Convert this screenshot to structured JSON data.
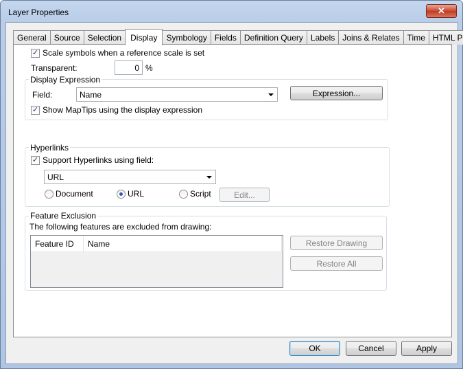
{
  "window": {
    "title": "Layer Properties",
    "close_glyph": "✕"
  },
  "tabs": [
    {
      "label": "General",
      "active": false
    },
    {
      "label": "Source",
      "active": false
    },
    {
      "label": "Selection",
      "active": false
    },
    {
      "label": "Display",
      "active": true
    },
    {
      "label": "Symbology",
      "active": false
    },
    {
      "label": "Fields",
      "active": false
    },
    {
      "label": "Definition Query",
      "active": false
    },
    {
      "label": "Labels",
      "active": false
    },
    {
      "label": "Joins & Relates",
      "active": false
    },
    {
      "label": "Time",
      "active": false
    },
    {
      "label": "HTML Popup",
      "active": false
    }
  ],
  "display": {
    "scale_symbols_label": "Scale symbols when a reference scale is set",
    "scale_symbols_checked": true,
    "transparent_label": "Transparent:",
    "transparent_value": "0",
    "transparent_unit": "%"
  },
  "display_expression": {
    "group_label": "Display Expression",
    "field_label": "Field:",
    "field_value": "Name",
    "expression_button": "Expression...",
    "maptips_label": "Show MapTips using the display expression",
    "maptips_checked": true
  },
  "hyperlinks": {
    "group_label": "Hyperlinks",
    "support_label": "Support Hyperlinks using field:",
    "support_checked": true,
    "field_value": "URL",
    "radio_document": "Document",
    "radio_url": "URL",
    "radio_script": "Script",
    "selected": "URL",
    "edit_button": "Edit..."
  },
  "feature_exclusion": {
    "group_label": "Feature Exclusion",
    "description": "The following features are excluded from drawing:",
    "columns": [
      "Feature ID",
      "Name"
    ],
    "rows": [],
    "restore_drawing_button": "Restore Drawing",
    "restore_all_button": "Restore All"
  },
  "footer": {
    "ok_button": "OK",
    "cancel_button": "Cancel",
    "apply_button": "Apply"
  },
  "check_glyph": "✓"
}
